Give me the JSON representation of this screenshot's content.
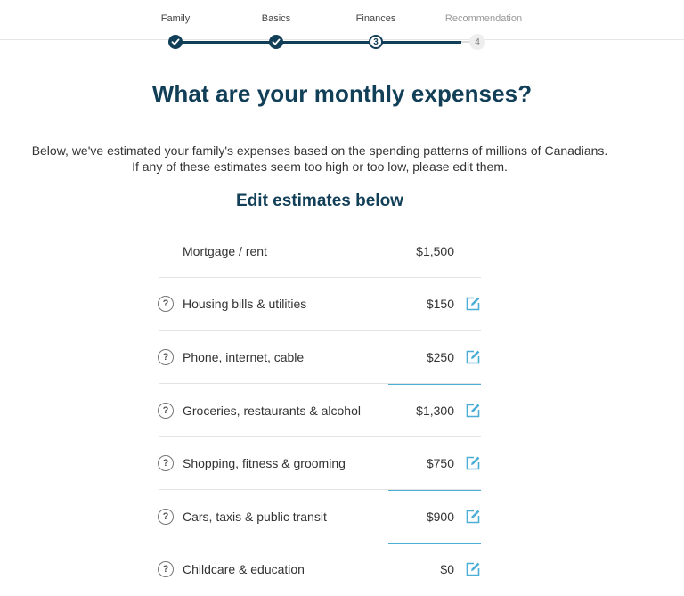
{
  "progress": {
    "steps": [
      {
        "label": "Family",
        "status": "done",
        "number": ""
      },
      {
        "label": "Basics",
        "status": "done",
        "number": ""
      },
      {
        "label": "Finances",
        "status": "current",
        "number": "3"
      },
      {
        "label": "Recommendation",
        "status": "future",
        "number": "4"
      }
    ],
    "colors": {
      "active": "#123f58",
      "inactive": "#dcdcdc"
    }
  },
  "page": {
    "title": "What are your monthly expenses?",
    "intro_line1": "Below, we've estimated your family's expenses based on the spending patterns of millions of Canadians.",
    "intro_line2": "If any of these estimates seem too high or too low, please edit them.",
    "subtitle": "Edit estimates below"
  },
  "expenses": [
    {
      "label": "Mortgage / rent",
      "amount": "$1,500",
      "help_icon": "",
      "editable": false
    },
    {
      "label": "Housing bills & utilities",
      "amount": "$150",
      "help_icon": "?",
      "editable": true
    },
    {
      "label": "Phone, internet, cable",
      "amount": "$250",
      "help_icon": "?",
      "editable": true
    },
    {
      "label": "Groceries, restaurants & alcohol",
      "amount": "$1,300",
      "help_icon": "?",
      "editable": true
    },
    {
      "label": "Shopping, fitness & grooming",
      "amount": "$750",
      "help_icon": "?",
      "editable": true
    },
    {
      "label": "Cars, taxis & public transit",
      "amount": "$900",
      "help_icon": "?",
      "editable": true
    },
    {
      "label": "Childcare & education",
      "amount": "$0",
      "help_icon": "?",
      "editable": true
    }
  ],
  "icons": {
    "help": "question-circle-icon",
    "edit": "edit-pencil-icon",
    "done": "check-icon"
  },
  "accent_color": "#4aaed6"
}
